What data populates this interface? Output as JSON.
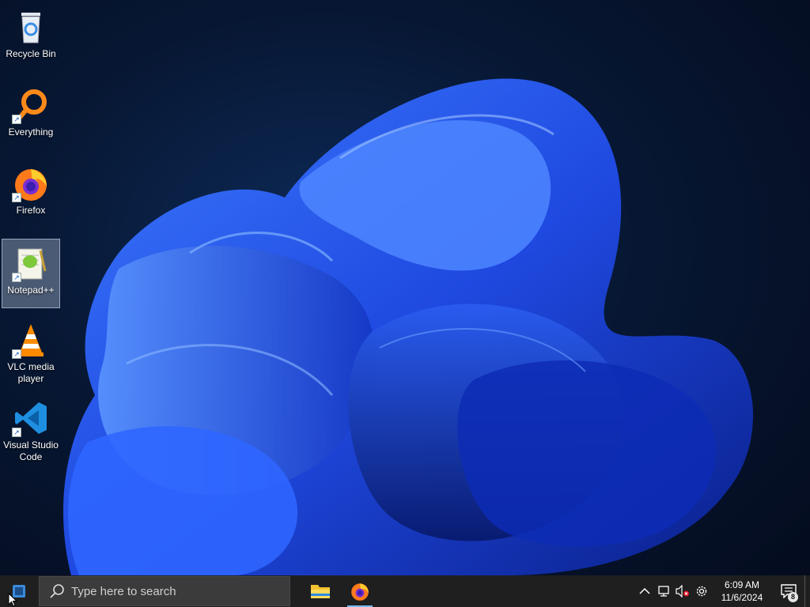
{
  "desktop": {
    "icons": [
      {
        "label": "Recycle Bin",
        "icon": "recycle-bin-icon",
        "shortcut": false,
        "selected": false
      },
      {
        "label": "Everything",
        "icon": "everything-search-icon",
        "shortcut": true,
        "selected": false
      },
      {
        "label": "Firefox",
        "icon": "firefox-icon",
        "shortcut": true,
        "selected": false
      },
      {
        "label": "Notepad++",
        "icon": "notepadpp-icon",
        "shortcut": true,
        "selected": true
      },
      {
        "label": "VLC media player",
        "icon": "vlc-icon",
        "shortcut": true,
        "selected": false
      },
      {
        "label": "Visual Studio Code",
        "icon": "vscode-icon",
        "shortcut": true,
        "selected": false
      }
    ]
  },
  "taskbar": {
    "search": {
      "placeholder": "Type here to search"
    },
    "pinned": [
      {
        "name": "File Explorer",
        "icon": "file-explorer-icon",
        "running": false
      },
      {
        "name": "Firefox",
        "icon": "firefox-icon",
        "running": true
      }
    ],
    "tray": {
      "icons": [
        "chevron-up-icon",
        "network-icon",
        "volume-muted-icon",
        "settings-gear-icon"
      ]
    },
    "clock": {
      "time": "6:09 AM",
      "date": "11/6/2024"
    },
    "notifications": {
      "count": "8"
    }
  },
  "colors": {
    "taskbar": "#1f1f20",
    "accent": "#76b9ed",
    "wallpaper_bloom": "#2b5bff"
  }
}
